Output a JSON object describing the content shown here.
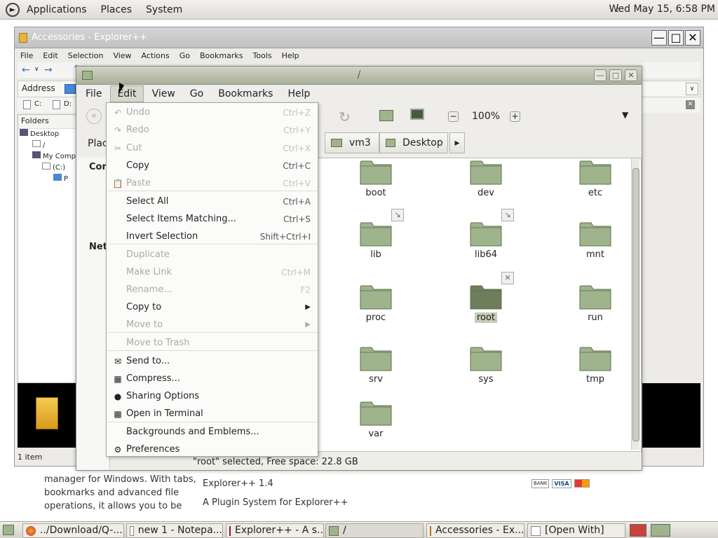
{
  "top_panel": {
    "menus": [
      "Applications",
      "Places",
      "System"
    ],
    "clock": "Wed May 15,  6:58 PM"
  },
  "web_page": {
    "left_text": [
      "manager for Windows. With tabs,",
      "bookmarks and advanced file",
      "operations, it allows you to be"
    ],
    "center_text": [
      "Explorer++ 1.4",
      "A Plugin System for Explorer++"
    ],
    "payment_labels": [
      "BANK",
      "VISA"
    ]
  },
  "explorer": {
    "title": "Accessories - Explorer++",
    "menu": [
      "File",
      "Edit",
      "Selection",
      "View",
      "Actions",
      "Go",
      "Bookmarks",
      "Tools",
      "Help"
    ],
    "address_label": "Address",
    "drives": [
      "C:",
      "D:"
    ],
    "folders_label": "Folders",
    "tree": [
      "Desktop",
      "/",
      "My Comp",
      "(C:)",
      "P"
    ],
    "status": "1 item"
  },
  "nautilus": {
    "title": "/",
    "menu": [
      "File",
      "Edit",
      "View",
      "Go",
      "Bookmarks",
      "Help"
    ],
    "zoom": "100%",
    "places_label": "Plac",
    "breadcrumbs": [
      "vm3",
      "Desktop"
    ],
    "side_labels": [
      "Com",
      "Netw"
    ],
    "folders": [
      "boot",
      "dev",
      "etc",
      "lib",
      "lib64",
      "mnt",
      "proc",
      "root",
      "run",
      "srv",
      "sys",
      "tmp",
      "var"
    ],
    "selected_folder": "root",
    "status": "\"root\" selected, Free space: 22.8 GB"
  },
  "edit_menu": {
    "items": [
      {
        "label": "Undo",
        "accel": "Ctrl+Z",
        "enabled": false
      },
      {
        "label": "Redo",
        "accel": "Ctrl+Y",
        "enabled": false
      },
      {
        "label": "Cut",
        "accel": "Ctrl+X",
        "enabled": false
      },
      {
        "label": "Copy",
        "accel": "Ctrl+C",
        "enabled": true
      },
      {
        "label": "Paste",
        "accel": "Ctrl+V",
        "enabled": false
      },
      {
        "label": "Select All",
        "accel": "Ctrl+A",
        "enabled": true
      },
      {
        "label": "Select Items Matching...",
        "accel": "Ctrl+S",
        "enabled": true
      },
      {
        "label": "Invert Selection",
        "accel": "Shift+Ctrl+I",
        "enabled": true
      },
      {
        "label": "Duplicate",
        "accel": "",
        "enabled": false
      },
      {
        "label": "Make Link",
        "accel": "Ctrl+M",
        "enabled": false
      },
      {
        "label": "Rename...",
        "accel": "F2",
        "enabled": false
      },
      {
        "label": "Copy to",
        "accel": "",
        "enabled": true
      },
      {
        "label": "Move to",
        "accel": "",
        "enabled": false
      },
      {
        "label": "Move to Trash",
        "accel": "",
        "enabled": false
      },
      {
        "label": "Send to...",
        "accel": "",
        "enabled": true
      },
      {
        "label": "Compress...",
        "accel": "",
        "enabled": true
      },
      {
        "label": "Sharing Options",
        "accel": "",
        "enabled": true
      },
      {
        "label": "Open in Terminal",
        "accel": "",
        "enabled": true
      },
      {
        "label": "Backgrounds and Emblems...",
        "accel": "",
        "enabled": true
      },
      {
        "label": "Preferences",
        "accel": "",
        "enabled": true
      }
    ]
  },
  "taskbar": {
    "tasks": [
      "../Download/Q-...",
      "new 1 - Notepa...",
      "Explorer++ - A s...",
      "/",
      "Accessories - Ex...",
      "[Open With]"
    ]
  },
  "colors": {
    "folder_green": "#9fb48c",
    "folder_dark": "#6d7f5a",
    "selection": "#c7ccb8"
  }
}
